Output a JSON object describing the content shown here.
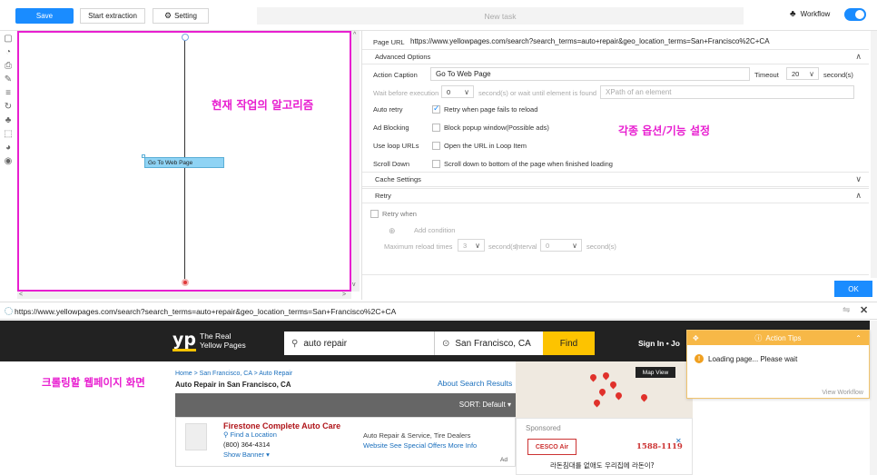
{
  "toolbar": {
    "save_label": "Save",
    "start_label": "Start extraction",
    "setting_label": "Setting",
    "task_title": "New task",
    "workflow_label": "Workflow"
  },
  "canvas": {
    "annotation": "현재 작업의 알고리즘",
    "node_label": "Go To Web Page"
  },
  "panel": {
    "page_url_label": "Page URL",
    "page_url_value": "https://www.yellowpages.com/search?search_terms=auto+repair&geo_location_terms=San+Francisco%2C+CA",
    "advanced_options": "Advanced Options",
    "action_caption_label": "Action Caption",
    "action_caption_value": "Go To Web Page",
    "timeout_label": "Timeout",
    "timeout_value": "20",
    "seconds_label": "second(s)",
    "wait_label": "Wait before execution",
    "wait_value": "0",
    "wait_suffix": "second(s) or wait until element is found",
    "xpath_placeholder": "XPath of an element",
    "auto_retry_label": "Auto retry",
    "auto_retry_text": "Retry when page fails to reload",
    "ad_blocking_label": "Ad Blocking",
    "ad_blocking_text": "Block popup window(Possible ads)",
    "loop_urls_label": "Use loop URLs",
    "loop_urls_text": "Open the URL in Loop Item",
    "scroll_down_label": "Scroll Down",
    "scroll_down_text": "Scroll down to bottom of the page when finished loading",
    "cache_settings": "Cache Settings",
    "retry": "Retry",
    "retry_when": "Retry when",
    "add_condition": "Add condition",
    "max_reload_label": "Maximum reload times",
    "max_reload_value": "3",
    "interval_label": "Interval",
    "interval_value": "0",
    "annotation": "각종 옵션/기능 설정",
    "ok_label": "OK"
  },
  "browser": {
    "url": "https://www.yellowpages.com/search?search_terms=auto+repair&geo_location_terms=San+Francisco%2C+CA"
  },
  "webpage": {
    "annotation": "크롤링할 웹페이지 화면",
    "logo_mark": "yp",
    "logo_line1": "The Real",
    "logo_line2": "Yellow Pages",
    "search_value": "auto repair",
    "location_value": "San Francisco, CA",
    "find_label": "Find",
    "signin_label": "Sign In  •  Jo",
    "breadcrumb": "Home > San Francisco, CA > Auto Repair",
    "page_heading": "Auto Repair in San Francisco, CA",
    "about_link": "About Search Results",
    "sort_label": "SORT: Default ▾",
    "listing": {
      "name": "Firestone Complete Auto Care",
      "find_location": "Find a Location",
      "phone": "(800) 364-4314",
      "show_banner": "Show Banner ▾",
      "categories": "Auto Repair & Service, Tire Dealers",
      "links": "Website   See Special Offers   More Info",
      "ad": "Ad"
    },
    "map_view_label": "Map View",
    "sponsored_label": "Sponsored",
    "sponsor_logo": "CESCO Air",
    "sponsor_phone": "1588-1119",
    "sponsor_text": "라돈침대를 없애도 우리집에 라돈이?"
  },
  "tips": {
    "title": "Action Tips",
    "message": "Loading page... Please wait",
    "link": "View Workflow"
  },
  "colors": {
    "accent": "#1a8cff",
    "annotation": "#e81fd0",
    "yp_yellow": "#fdc300",
    "tips_orange": "#f7b847"
  }
}
